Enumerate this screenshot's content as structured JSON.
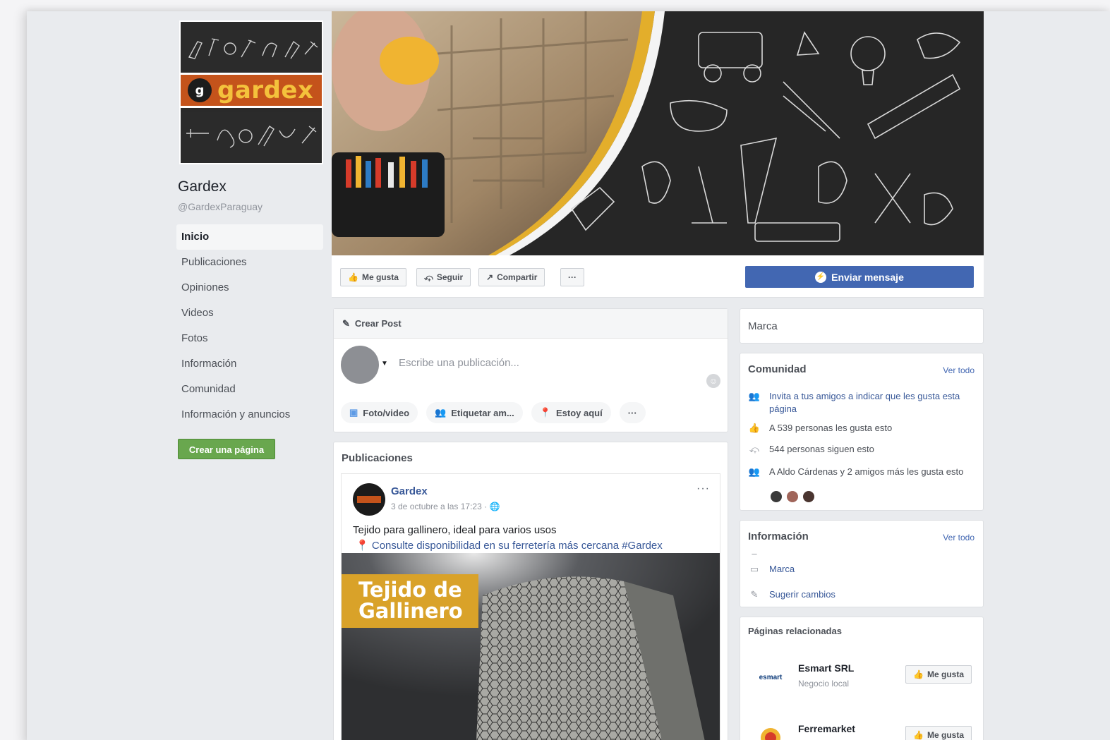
{
  "page": {
    "name": "Gardex",
    "handle": "@GardexParaguay",
    "logo_text": "gardex",
    "logo_mark": "g"
  },
  "nav": {
    "items": [
      "Inicio",
      "Publicaciones",
      "Opiniones",
      "Videos",
      "Fotos",
      "Información",
      "Comunidad",
      "Información y anuncios"
    ],
    "active": "Inicio"
  },
  "sidebar": {
    "create_page_label": "Crear una página"
  },
  "actions": {
    "like": "Me gusta",
    "follow": "Seguir",
    "share": "Compartir",
    "more": "···",
    "send_message": "Enviar mensaje"
  },
  "composer": {
    "title": "Crear Post",
    "placeholder": "Escribe una publicación...",
    "photo_video": "Foto/video",
    "tag": "Etiquetar am...",
    "checkin": "Estoy aquí",
    "more": "···"
  },
  "posts": {
    "title": "Publicaciones",
    "items": [
      {
        "author": "Gardex",
        "meta": "3 de octubre a las 17:23 · ",
        "text": "Tejido para gallinero, ideal para varios usos",
        "text2": "Consulte disponibilidad en su ferretería más cercana #Gardex",
        "image_label_line1": "Tejido de",
        "image_label_line2": "Gallinero",
        "more": "···"
      }
    ]
  },
  "right": {
    "marca": "Marca",
    "community": {
      "title": "Comunidad",
      "see_all": "Ver todo",
      "invite": "Invita a tus amigos a indicar que les gusta esta página",
      "likes": "A 539 personas les gusta esto",
      "follows": "544 personas siguen esto",
      "friends": "A Aldo Cárdenas y 2 amigos más les gusta esto"
    },
    "info": {
      "title": "Información",
      "see_all": "Ver todo",
      "dash": "–",
      "category": "Marca",
      "suggest": "Sugerir cambios"
    },
    "related": {
      "title": "Páginas relacionadas",
      "items": [
        {
          "name": "Esmart SRL",
          "sub": "Negocio local",
          "logo": "esmart",
          "like": "Me gusta"
        },
        {
          "name": "Ferremarket",
          "sub": "",
          "logo": "",
          "like": "Me gusta"
        }
      ]
    }
  },
  "colors": {
    "facebook_blue": "#4267b2",
    "brand_orange": "#c4531b",
    "brand_yellow": "#f4c23c",
    "green_button": "#69a74e"
  }
}
